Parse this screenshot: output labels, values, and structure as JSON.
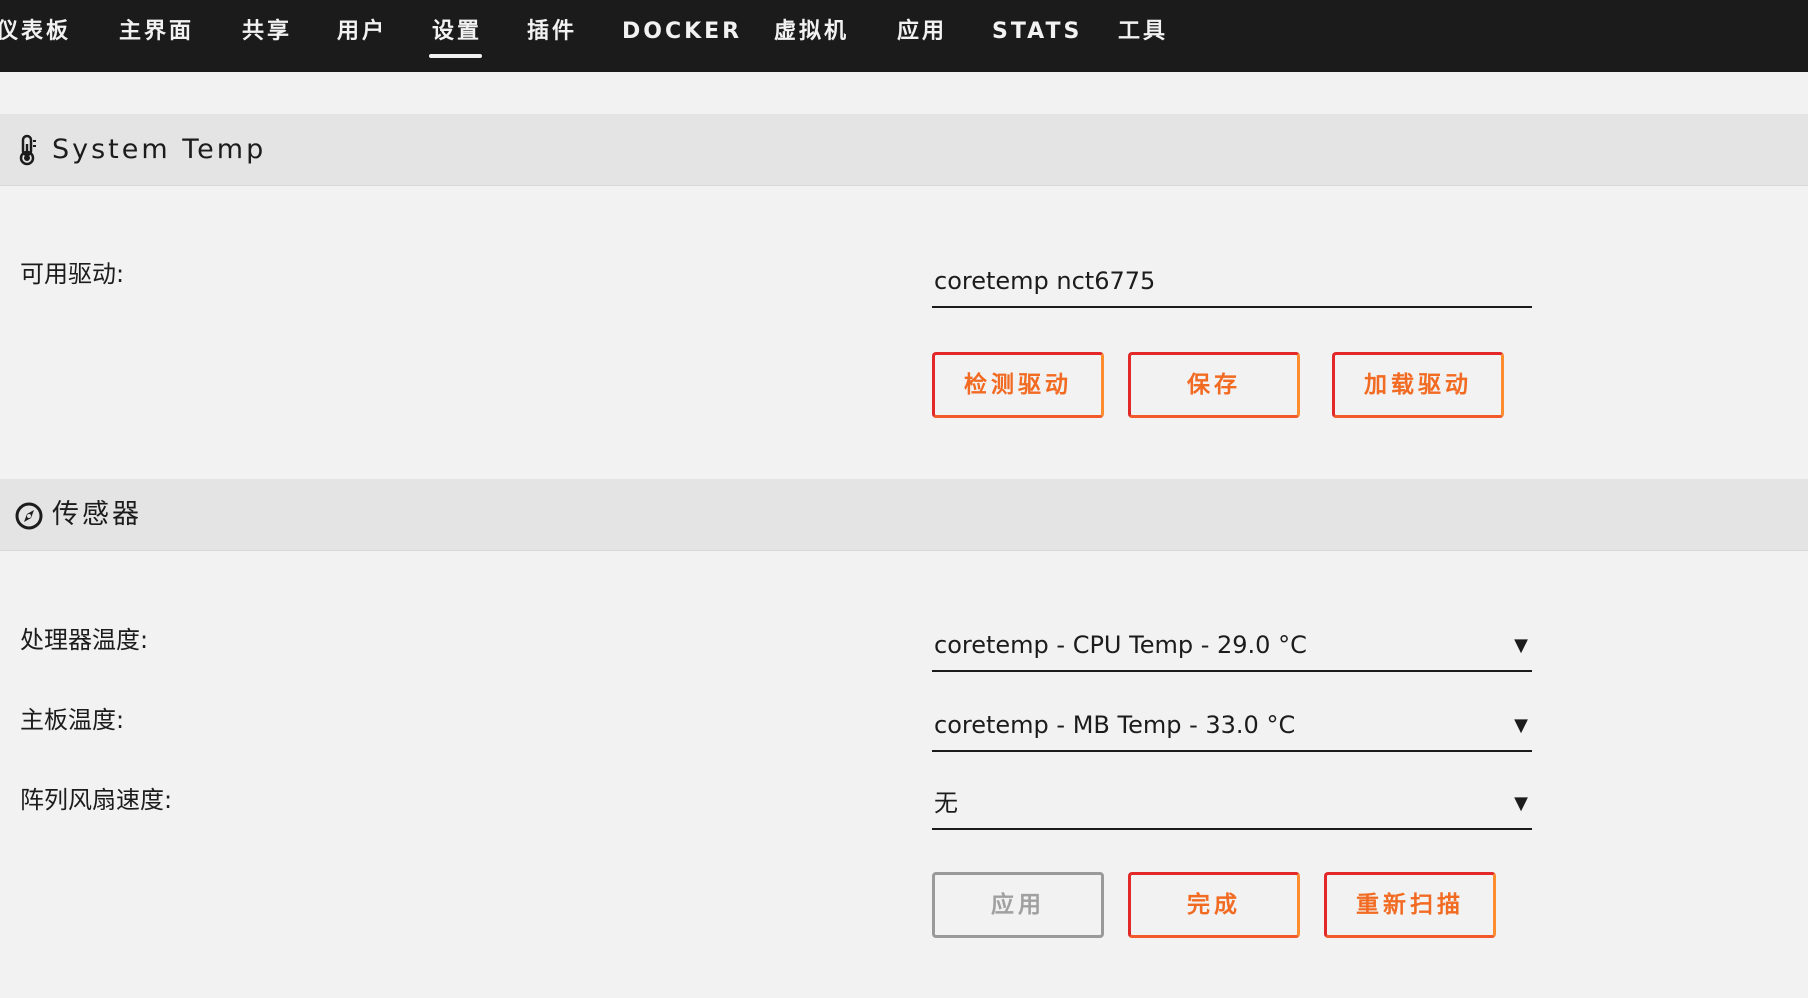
{
  "nav": {
    "items": [
      {
        "label": "仪表板"
      },
      {
        "label": "主界面"
      },
      {
        "label": "共享"
      },
      {
        "label": "用户"
      },
      {
        "label": "设置",
        "active": true
      },
      {
        "label": "插件"
      },
      {
        "label": "DOCKER"
      },
      {
        "label": "虚拟机"
      },
      {
        "label": "应用"
      },
      {
        "label": "STATS"
      },
      {
        "label": "工具"
      }
    ]
  },
  "system_temp": {
    "title": "System Temp",
    "icon": "thermometer-icon",
    "drivers_label": "可用驱动:",
    "drivers_value": "coretemp nct6775",
    "buttons": {
      "detect": "检测驱动",
      "save": "保存",
      "load": "加载驱动"
    }
  },
  "sensors": {
    "title": "传感器",
    "icon": "compass-icon",
    "cpu_label": "处理器温度:",
    "cpu_value": "coretemp - CPU Temp - 29.0 °C",
    "mb_label": "主板温度:",
    "mb_value": "coretemp - MB Temp - 33.0 °C",
    "fan_label": "阵列风扇速度:",
    "fan_value": "无",
    "buttons": {
      "apply": "应用",
      "done": "完成",
      "rescan": "重新扫描"
    }
  },
  "colors": {
    "nav_bg": "#1c1b1b",
    "accent_red": "#e22828",
    "accent_orange": "#ff8c2f",
    "page_bg": "#f2f2f2"
  }
}
